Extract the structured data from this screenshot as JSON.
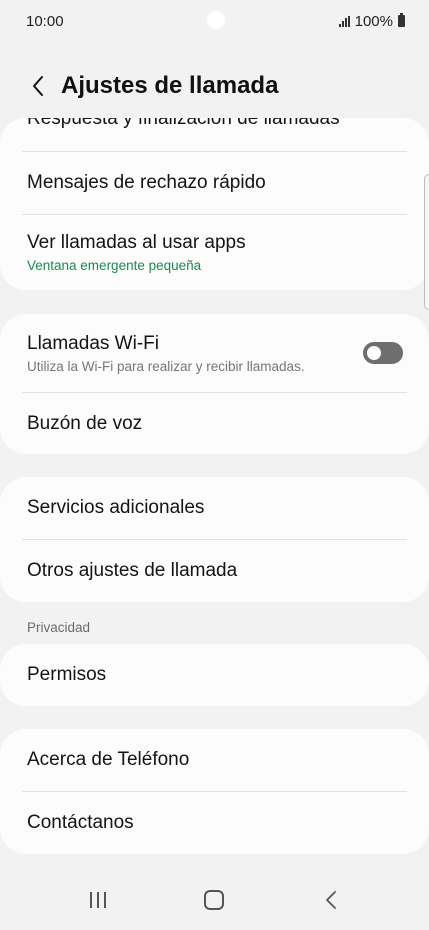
{
  "status": {
    "time": "10:00",
    "battery": "100%"
  },
  "header": {
    "title": "Ajustes de llamada"
  },
  "group1": {
    "partial_item": "Respuesta y finalización de llamadas",
    "items": [
      {
        "title": "Mensajes de rechazo rápido"
      },
      {
        "title": "Ver llamadas al usar apps",
        "subtitle": "Ventana emergente pequeña"
      }
    ]
  },
  "group2": {
    "wifi_calling": {
      "title": "Llamadas Wi-Fi",
      "subtitle": "Utiliza la Wi-Fi para realizar y recibir llamadas.",
      "enabled": false
    },
    "voicemail": {
      "title": "Buzón de voz"
    }
  },
  "group3": {
    "items": [
      {
        "title": "Servicios adicionales"
      },
      {
        "title": "Otros ajustes de llamada"
      }
    ]
  },
  "privacy": {
    "label": "Privacidad",
    "items": [
      {
        "title": "Permisos"
      }
    ]
  },
  "group5": {
    "items": [
      {
        "title": "Acerca de Teléfono"
      },
      {
        "title": "Contáctanos"
      }
    ]
  },
  "colors": {
    "accent_green": "#1b8a52",
    "toggle_off": "#6e6e6e"
  },
  "icons": {
    "back": "chevron-left-icon",
    "recents": "recents-icon",
    "home": "home-icon",
    "nav_back": "nav-back-icon"
  }
}
